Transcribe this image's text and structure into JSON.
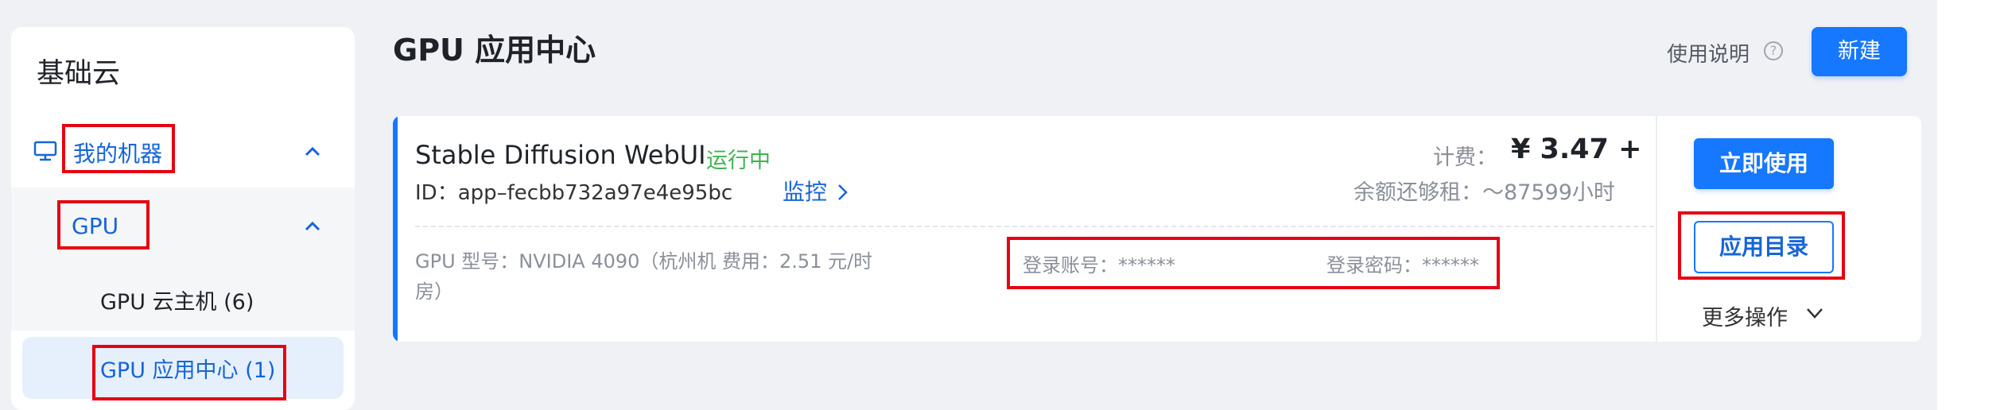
{
  "sidebar": {
    "title": "基础云",
    "items": [
      {
        "label": "我的机器",
        "icon": "monitor-icon"
      },
      {
        "label": "GPU"
      },
      {
        "label": "GPU 云主机 (6)"
      },
      {
        "label": "GPU 应用中心 (1)"
      }
    ]
  },
  "header": {
    "title": "GPU 应用中心",
    "help_label": "使用说明",
    "help_icon": "?",
    "new_button": "新建"
  },
  "card": {
    "app_name": "Stable Diffusion WebUI",
    "status": "运行中",
    "id_text": "ID：app–fecbb732a97e4e95bc",
    "monitor_link": "监控",
    "price_label": "计费：",
    "price_value": "¥ 3.47 +",
    "remaining_text": "余额还够租：～87599小时",
    "spec_text": "GPU 型号：NVIDIA 4090（杭州机 费用：2.51 元/时房）",
    "account_text": "登录账号：******",
    "password_text": "登录密码：******",
    "use_button": "立即使用",
    "dir_button": "应用目录",
    "more_label": "更多操作"
  },
  "colors": {
    "primary": "#1677ff",
    "status_running": "#3fb34f",
    "highlight_box": "#e60012"
  }
}
